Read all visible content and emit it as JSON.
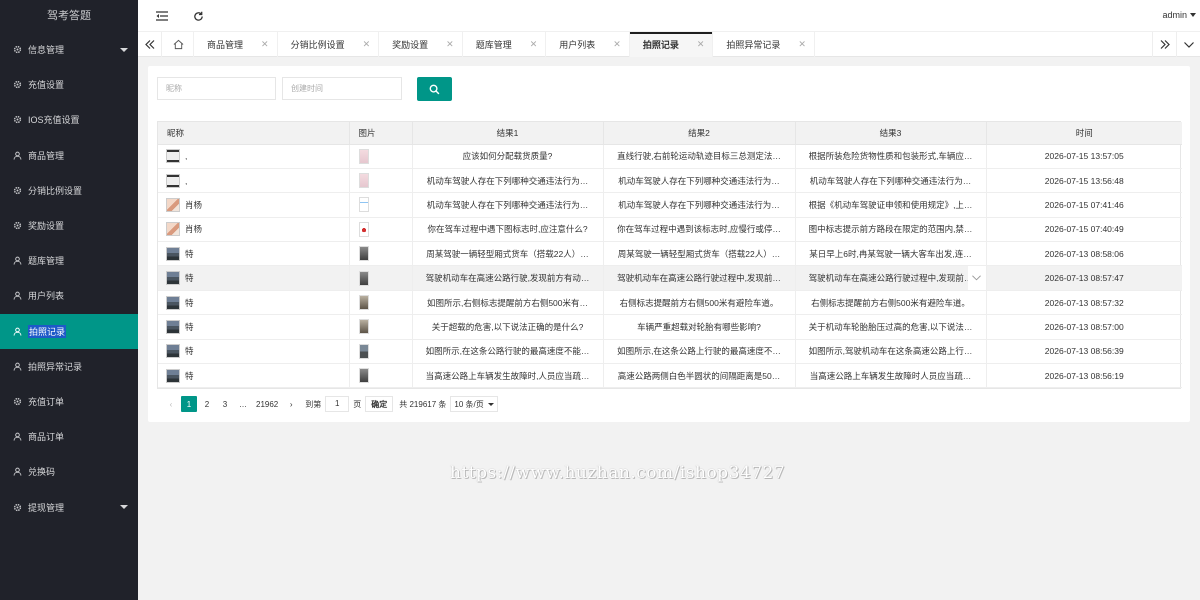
{
  "sidebar": {
    "logo": "驾考答题",
    "items": [
      {
        "label": "信息管理",
        "icon": "gear-icon",
        "arrow": true,
        "active": false
      },
      {
        "label": "充值设置",
        "icon": "gear-icon",
        "arrow": false,
        "active": false
      },
      {
        "label": "IOS充值设置",
        "icon": "gear-icon",
        "arrow": false,
        "active": false
      },
      {
        "label": "商品管理",
        "icon": "user-icon",
        "arrow": false,
        "active": false
      },
      {
        "label": "分销比例设置",
        "icon": "gear-icon",
        "arrow": false,
        "active": false
      },
      {
        "label": "奖励设置",
        "icon": "gear-icon",
        "arrow": false,
        "active": false
      },
      {
        "label": "题库管理",
        "icon": "user-icon",
        "arrow": false,
        "active": false
      },
      {
        "label": "用户列表",
        "icon": "user-icon",
        "arrow": false,
        "active": false
      },
      {
        "label": "拍照记录",
        "icon": "user-icon",
        "arrow": false,
        "active": true
      },
      {
        "label": "拍照异常记录",
        "icon": "user-icon",
        "arrow": false,
        "active": false
      },
      {
        "label": "充值订单",
        "icon": "gear-icon",
        "arrow": false,
        "active": false
      },
      {
        "label": "商品订单",
        "icon": "user-icon",
        "arrow": false,
        "active": false
      },
      {
        "label": "兑换码",
        "icon": "user-icon",
        "arrow": false,
        "active": false
      },
      {
        "label": "提现管理",
        "icon": "gear-icon",
        "arrow": true,
        "active": false
      }
    ]
  },
  "header": {
    "user": "admin"
  },
  "tabs": [
    {
      "label": "商品管理",
      "active": false
    },
    {
      "label": "分销比例设置",
      "active": false
    },
    {
      "label": "奖励设置",
      "active": false
    },
    {
      "label": "题库管理",
      "active": false
    },
    {
      "label": "用户列表",
      "active": false
    },
    {
      "label": "拍照记录",
      "active": true
    },
    {
      "label": "拍照异常记录",
      "active": false
    }
  ],
  "search": {
    "nickname_placeholder": "昵称",
    "created_placeholder": "创建时间"
  },
  "table": {
    "columns": [
      "昵称",
      "图片",
      "结果1",
      "结果2",
      "结果3",
      "时间"
    ],
    "rows": [
      {
        "nick": ",",
        "avatar": "phone",
        "thumb": "pink",
        "r1": "应该如何分配载货质量?",
        "r2": "直线行驶,右前轮运动轨迹目标三总测定法…",
        "r3": "根据所装危险货物性质和包装形式,车辆应…",
        "time": "2026-07-15 13:57:05"
      },
      {
        "nick": ",",
        "avatar": "phone",
        "thumb": "pink",
        "r1": "机动车驾驶人存在下列哪种交通违法行为…",
        "r2": "机动车驾驶人存在下列哪种交通违法行为…",
        "r3": "机动车驾驶人存在下列哪种交通违法行为…",
        "time": "2026-07-15 13:56:48"
      },
      {
        "nick": "肖杨",
        "avatar": "person",
        "thumb": "white",
        "r1": "机动车驾驶人存在下列哪种交通违法行为…",
        "r2": "机动车驾驶人存在下列哪种交通违法行为…",
        "r3": "根据《机动车驾驶证申领和使用规定》,上…",
        "time": "2026-07-15 07:41:46"
      },
      {
        "nick": "肖杨",
        "avatar": "person",
        "thumb": "redsign",
        "r1": "你在驾车过程中遇下图标志时,应注意什么?",
        "r2": "你在驾车过程中遇到该标志时,应慢行或停…",
        "r3": "图中标志提示前方路段在限定的范围内,禁…",
        "time": "2026-07-15 07:40:49"
      },
      {
        "nick": "特",
        "avatar": "road",
        "thumb": "dark",
        "r1": "周某驾驶一辆轻型厢式货车（搭载22人）…",
        "r2": "周某驾驶一辆轻型厢式货车（搭载22人）…",
        "r3": "某日早上6时,冉某驾驶一辆大客车出发,连…",
        "time": "2026-07-13 08:58:06"
      },
      {
        "nick": "特",
        "avatar": "road",
        "thumb": "dark",
        "r1": "驾驶机动车在高速公路行驶,发现前方有动…",
        "r2": "驾驶机动车在高速公路行驶过程中,发现前…",
        "r3": "驾驶机动车在高速公路行驶过程中,发现前…",
        "time": "2026-07-13 08:57:47",
        "hover": true
      },
      {
        "nick": "特",
        "avatar": "road",
        "thumb": "dark2",
        "r1": "如图所示,右侧标志提醒前方右侧500米有…",
        "r2": "右侧标志提醒前方右侧500米有避险车道。",
        "r3": "右侧标志提醒前方右侧500米有避险车道。",
        "time": "2026-07-13 08:57:32"
      },
      {
        "nick": "特",
        "avatar": "road",
        "thumb": "dark2",
        "r1": "关于超载的危害,以下说法正确的是什么?",
        "r2": "车辆严重超载对轮胎有哪些影响?",
        "r3": "关于机动车轮胎胎压过高的危害,以下说法…",
        "time": "2026-07-13 08:57:00"
      },
      {
        "nick": "特",
        "avatar": "road",
        "thumb": "road",
        "r1": "如图所示,在这条公路行驶的最高速度不能…",
        "r2": "如图所示,在这条公路上行驶的最高速度不…",
        "r3": "如图所示,驾驶机动车在这条高速公路上行…",
        "time": "2026-07-13 08:56:39"
      },
      {
        "nick": "特",
        "avatar": "road",
        "thumb": "dark",
        "r1": "当高速公路上车辆发生故障时,人员应当疏…",
        "r2": "高速公路两侧白色半圆状的间隔距离是50…",
        "r3": "当高速公路上车辆发生故障时人员应当疏…",
        "time": "2026-07-13 08:56:19"
      }
    ]
  },
  "pagination": {
    "pages": [
      "1",
      "2",
      "3",
      "…",
      "21962"
    ],
    "current": "1",
    "goto_label": "到第",
    "goto_value": "1",
    "page_unit": "页",
    "confirm": "确定",
    "total": "共 219617 条",
    "page_size": "10 条/页"
  },
  "watermark": "https://www.huzhan.com/ishop34727"
}
